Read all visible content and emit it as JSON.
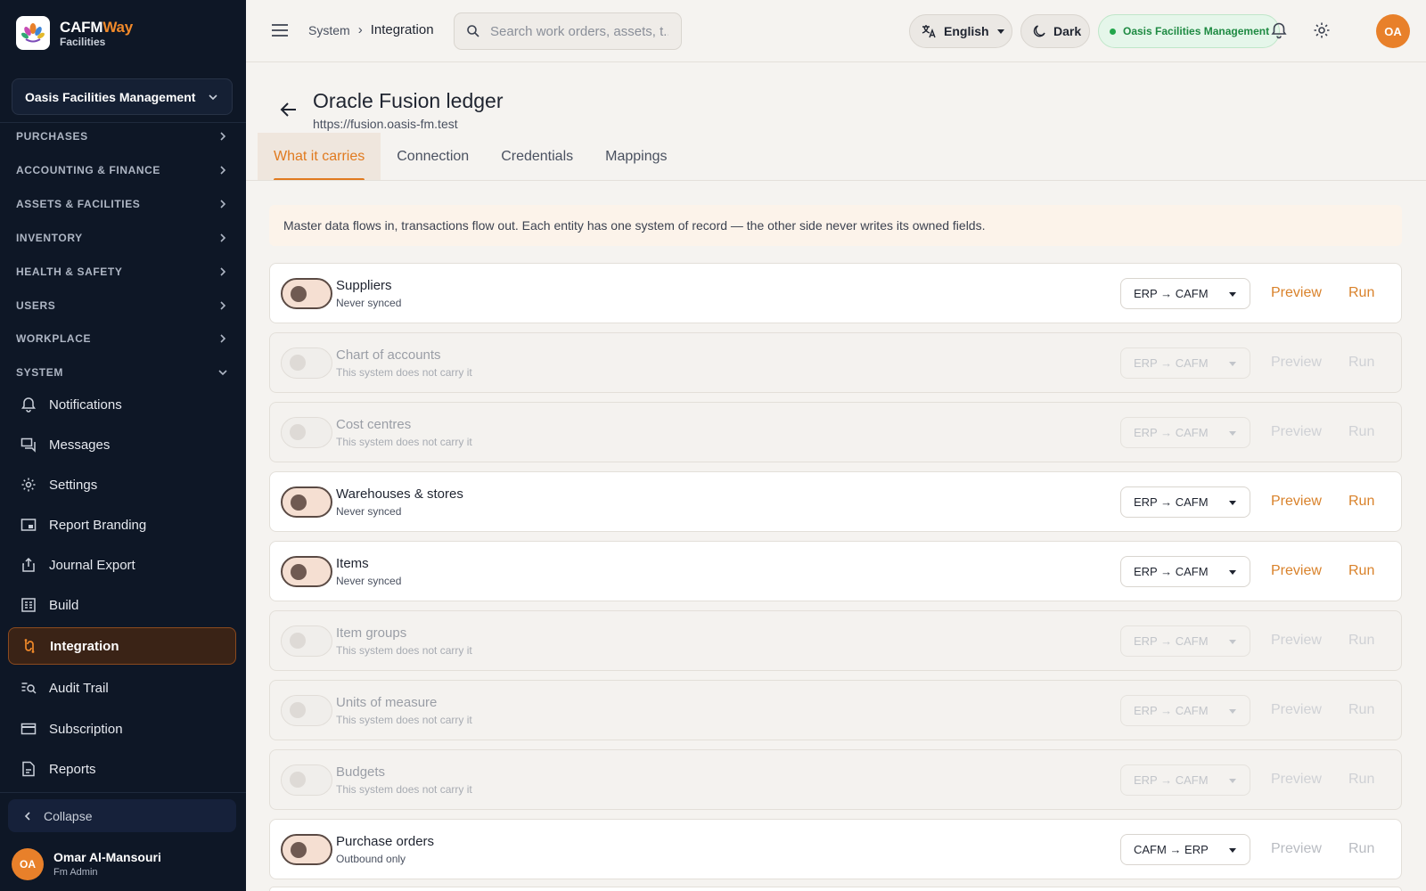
{
  "brand": {
    "name_main": "CAFM",
    "name_accent": "Way",
    "sub": "Facilities"
  },
  "sidebar": {
    "org_selector": "Oasis Facilities Management",
    "sections": [
      {
        "label": "PURCHASES"
      },
      {
        "label": "ACCOUNTING & FINANCE"
      },
      {
        "label": "ASSETS & FACILITIES"
      },
      {
        "label": "INVENTORY"
      },
      {
        "label": "HEALTH & SAFETY"
      },
      {
        "label": "USERS"
      },
      {
        "label": "WORKPLACE"
      },
      {
        "label": "SYSTEM"
      }
    ],
    "items": [
      {
        "label": "Notifications",
        "icon": "bell-icon"
      },
      {
        "label": "Messages",
        "icon": "messages-icon"
      },
      {
        "label": "Settings",
        "icon": "gear-icon"
      },
      {
        "label": "Report Branding",
        "icon": "branding-icon"
      },
      {
        "label": "Journal Export",
        "icon": "export-icon"
      },
      {
        "label": "Build",
        "icon": "build-icon"
      },
      {
        "label": "Integration",
        "icon": "integration-icon",
        "active": true
      },
      {
        "label": "Audit Trail",
        "icon": "audit-icon"
      },
      {
        "label": "Subscription",
        "icon": "card-icon"
      },
      {
        "label": "Reports",
        "icon": "reports-icon"
      }
    ],
    "collapse_label": "Collapse",
    "user": {
      "initials": "OA",
      "name": "Omar Al-Mansouri",
      "role": "Fm Admin"
    }
  },
  "topbar": {
    "breadcrumb": {
      "parent": "System",
      "current": "Integration"
    },
    "search_placeholder": "Search work orders, assets, t...",
    "language": "English",
    "theme": "Dark",
    "org_badge": "Oasis Facilities Management",
    "avatar_initials": "OA"
  },
  "page": {
    "title": "Oracle Fusion ledger",
    "url": "https://fusion.oasis-fm.test",
    "tabs": [
      "What it carries",
      "Connection",
      "Credentials",
      "Mappings"
    ],
    "active_tab": 0,
    "banner": "Master data flows in, transactions flow out. Each entity has one system of record — the other side never writes its owned fields."
  },
  "entities": [
    {
      "name": "Suppliers",
      "status": "Never synced",
      "enabled": true,
      "direction": "ERP → CAFM",
      "preview": "Preview",
      "run": "Run"
    },
    {
      "name": "Chart of accounts",
      "status": "This system does not carry it",
      "enabled": false,
      "direction": "ERP → CAFM",
      "preview": "Preview",
      "run": "Run"
    },
    {
      "name": "Cost centres",
      "status": "This system does not carry it",
      "enabled": false,
      "direction": "ERP → CAFM",
      "preview": "Preview",
      "run": "Run"
    },
    {
      "name": "Warehouses & stores",
      "status": "Never synced",
      "enabled": true,
      "direction": "ERP → CAFM",
      "preview": "Preview",
      "run": "Run"
    },
    {
      "name": "Items",
      "status": "Never synced",
      "enabled": true,
      "direction": "ERP → CAFM",
      "preview": "Preview",
      "run": "Run"
    },
    {
      "name": "Item groups",
      "status": "This system does not carry it",
      "enabled": false,
      "direction": "ERP → CAFM",
      "preview": "Preview",
      "run": "Run"
    },
    {
      "name": "Units of measure",
      "status": "This system does not carry it",
      "enabled": false,
      "direction": "ERP → CAFM",
      "preview": "Preview",
      "run": "Run"
    },
    {
      "name": "Budgets",
      "status": "This system does not carry it",
      "enabled": false,
      "direction": "ERP → CAFM",
      "preview": "Preview",
      "run": "Run"
    },
    {
      "name": "Purchase orders",
      "status": "Outbound only",
      "enabled": true,
      "direction": "CAFM → ERP",
      "preview": "Preview",
      "run": "Run",
      "actions_dim": true
    }
  ],
  "colors": {
    "accent": "#e07a1f",
    "sidebar_bg": "#0e1726",
    "active_nav_bg": "#3a2316",
    "success": "#22a64b"
  }
}
